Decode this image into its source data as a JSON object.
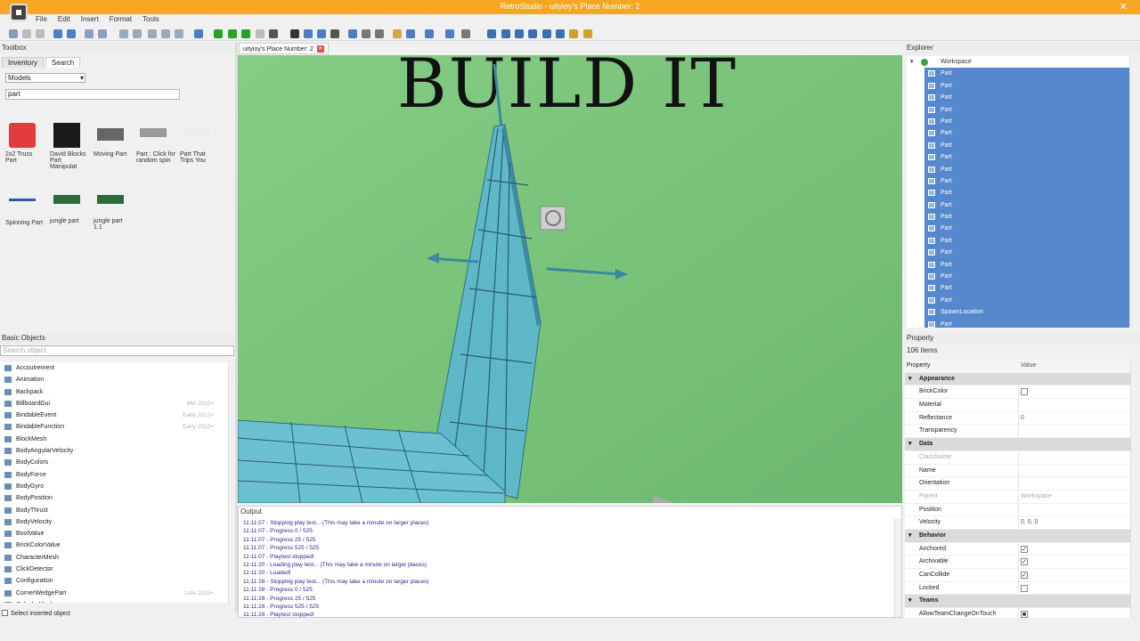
{
  "window": {
    "title": "RetroStudio - uityioy's Place Number: 2",
    "close": "✕"
  },
  "menu": [
    "File",
    "Edit",
    "Insert",
    "Format",
    "Tools"
  ],
  "toolbox": {
    "header": "Toolbox",
    "tabs": [
      "Inventory",
      "Search"
    ],
    "category": "Models",
    "search_value": "part",
    "models": [
      {
        "label": "2x2 Truss Part",
        "color": "#e23b3b"
      },
      {
        "label": "David Blocks Part Manipulat",
        "color": "#1a1a1a"
      },
      {
        "label": "Moving Part",
        "color": "#666666"
      },
      {
        "label": "Part : Click for random spin",
        "color": "#9a9a9a"
      },
      {
        "label": "Part That Trips You",
        "color": "#eeeeee"
      },
      {
        "label": "Spinning Part",
        "color": "#3355aa"
      },
      {
        "label": "jungle part",
        "color": "#2e6b3a"
      },
      {
        "label": "jungle part 1.1",
        "color": "#2e6b3a"
      }
    ]
  },
  "basic_objects": {
    "header": "Basic Objects",
    "search_placeholder": "Search object",
    "items": [
      {
        "label": "Accoutrement",
        "note": ""
      },
      {
        "label": "Animation",
        "note": ""
      },
      {
        "label": "Backpack",
        "note": ""
      },
      {
        "label": "BillboardGui",
        "note": "Mid 2010+"
      },
      {
        "label": "BindableEvent",
        "note": "Early 2012+"
      },
      {
        "label": "BindableFunction",
        "note": "Early 2012+"
      },
      {
        "label": "BlockMesh",
        "note": ""
      },
      {
        "label": "BodyAngularVelocity",
        "note": ""
      },
      {
        "label": "BodyColors",
        "note": ""
      },
      {
        "label": "BodyForce",
        "note": ""
      },
      {
        "label": "BodyGyro",
        "note": ""
      },
      {
        "label": "BodyPosition",
        "note": ""
      },
      {
        "label": "BodyThrust",
        "note": ""
      },
      {
        "label": "BodyVelocity",
        "note": ""
      },
      {
        "label": "BoolValue",
        "note": ""
      },
      {
        "label": "BrickColorValue",
        "note": ""
      },
      {
        "label": "CharacterMesh",
        "note": ""
      },
      {
        "label": "ClickDetector",
        "note": ""
      },
      {
        "label": "Configuration",
        "note": ""
      },
      {
        "label": "CornerWedgePart",
        "note": "Late 2010+"
      },
      {
        "label": "CylinderMesh",
        "note": ""
      }
    ],
    "select_inserted": "Select inserted object"
  },
  "viewport": {
    "tab": "uityioy's Place Number: 2",
    "tab_close": "✕",
    "overlay_text": "BUILD IT"
  },
  "output": {
    "header": "Output",
    "lines": [
      "11:11:07 - Stopping play test... (This may take a minute on larger places)",
      "11:11:07 - Progress 0 / 525",
      "11:11:07 - Progress 25 / 525",
      "11:11:07 - Progress 525 / 525",
      "11:11:07 - Playtest stopped!",
      "11:11:20 - Loading play test... (This may take a minute on larger places)",
      "11:11:20 - Loaded!",
      "11:11:28 - Stopping play test... (This may take a minute on larger places)",
      "11:11:28 - Progress 0 / 525",
      "11:11:28 - Progress 25 / 525",
      "11:11:28 - Progress 525 / 525",
      "11:11:28 - Playtest stopped!"
    ]
  },
  "explorer": {
    "header": "Explorer",
    "root": "Workspace",
    "items": [
      "Part",
      "Part",
      "Part",
      "Part",
      "Part",
      "Part",
      "Part",
      "Part",
      "Part",
      "Part",
      "Part",
      "Part",
      "Part",
      "Part",
      "Part",
      "Part",
      "Part",
      "Part",
      "Part",
      "Part",
      "SpawnLocation",
      "Part"
    ]
  },
  "properties": {
    "header": "Property",
    "count": "106 items",
    "col_property": "Property",
    "col_value": "Value",
    "rows": [
      {
        "type": "cat",
        "key": "Appearance"
      },
      {
        "type": "prop",
        "key": "BrickColor",
        "check": ""
      },
      {
        "type": "prop",
        "key": "Material",
        "value": ""
      },
      {
        "type": "prop",
        "key": "Reflectance",
        "value": "0"
      },
      {
        "type": "prop",
        "key": "Transparency",
        "value": ""
      },
      {
        "type": "cat",
        "key": "Data"
      },
      {
        "type": "prop",
        "key": "ClassName",
        "value": "",
        "dim": true
      },
      {
        "type": "prop",
        "key": "Name",
        "value": ""
      },
      {
        "type": "prop",
        "key": "Orientation",
        "value": ""
      },
      {
        "type": "prop",
        "key": "Parent",
        "value": "Workspace",
        "dim": true
      },
      {
        "type": "prop",
        "key": "Position",
        "value": ""
      },
      {
        "type": "prop",
        "key": "Velocity",
        "value": "0, 0, 0"
      },
      {
        "type": "cat",
        "key": "Behavior"
      },
      {
        "type": "prop",
        "key": "Anchored",
        "check": "✓"
      },
      {
        "type": "prop",
        "key": "Archivable",
        "check": "✓"
      },
      {
        "type": "prop",
        "key": "CanCollide",
        "check": "✓"
      },
      {
        "type": "prop",
        "key": "Locked",
        "check": ""
      },
      {
        "type": "cat",
        "key": "Teams"
      },
      {
        "type": "prop",
        "key": "AllowTeamChangeOnTouch",
        "check": "■"
      }
    ]
  }
}
